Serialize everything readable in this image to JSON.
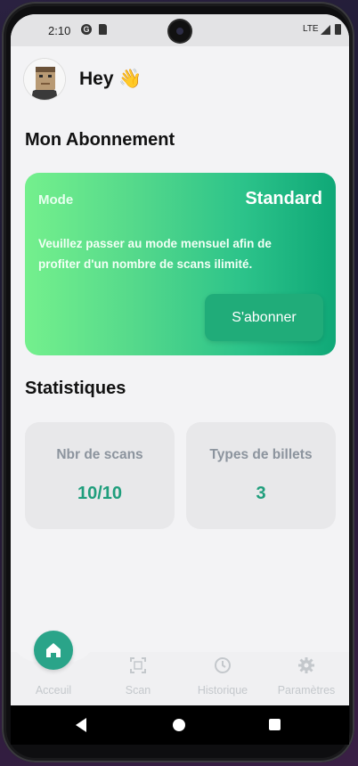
{
  "status_bar": {
    "time": "2:10",
    "network": "LTE"
  },
  "header": {
    "greeting": "Hey 👋"
  },
  "subscription": {
    "title": "Mon Abonnement",
    "mode_label": "Mode",
    "mode_value": "Standard",
    "message": "Veuillez passer au mode mensuel afin de profiter d'un nombre de scans ilimité.",
    "subscribe_label": "S'abonner"
  },
  "statistics": {
    "title": "Statistiques",
    "items": [
      {
        "label": "Nbr de scans",
        "value": "10/10"
      },
      {
        "label": "Types de billets",
        "value": "3"
      }
    ]
  },
  "nav": {
    "items": [
      {
        "label": "Acceuil",
        "icon": "home-icon",
        "active": true
      },
      {
        "label": "Scan",
        "icon": "scan-icon",
        "active": false
      },
      {
        "label": "Historique",
        "icon": "history-icon",
        "active": false
      },
      {
        "label": "Paramètres",
        "icon": "gear-icon",
        "active": false
      }
    ]
  },
  "colors": {
    "accent": "#1f9e7c",
    "card_start": "#74f08d",
    "card_end": "#0fa877"
  }
}
